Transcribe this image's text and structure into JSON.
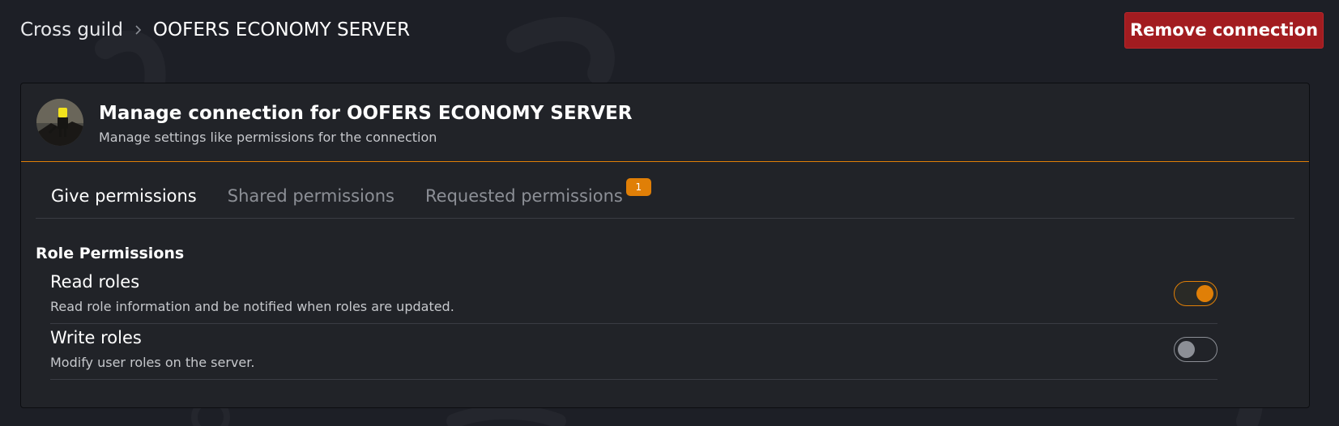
{
  "breadcrumb": {
    "parent": "Cross guild",
    "current": "OOFERS ECONOMY SERVER"
  },
  "actions": {
    "remove_label": "Remove connection"
  },
  "card": {
    "title": "Manage connection for OOFERS ECONOMY SERVER",
    "subtitle": "Manage settings like permissions for the connection"
  },
  "tabs": [
    {
      "label": "Give permissions",
      "active": true
    },
    {
      "label": "Shared permissions",
      "active": false
    },
    {
      "label": "Requested permissions",
      "active": false,
      "badge": "1"
    }
  ],
  "section": {
    "title": "Role Permissions"
  },
  "permissions": [
    {
      "name": "Read roles",
      "description": "Read role information and be notified when roles are updated.",
      "enabled": true
    },
    {
      "name": "Write roles",
      "description": "Modify user roles on the server.",
      "enabled": false
    }
  ],
  "colors": {
    "background": "#1d1f26",
    "card": "#212328",
    "accent": "#e07f07",
    "danger": "#a21c20"
  },
  "icons": {
    "breadcrumb_separator": "chevron-right-icon",
    "avatar": "server-avatar"
  }
}
